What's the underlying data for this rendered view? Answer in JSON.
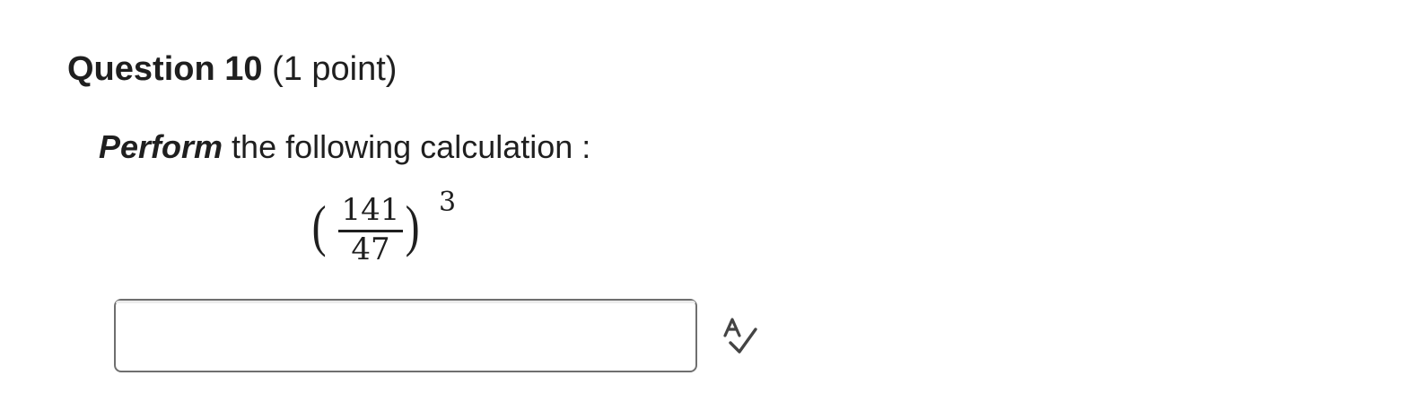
{
  "question": {
    "title": "Question 10",
    "points": "(1 point)"
  },
  "prompt": {
    "emphasis": "Perform",
    "text": " the following calculation :"
  },
  "expression": {
    "numerator": "141",
    "denominator": "47",
    "exponent": "3",
    "left_paren": "(",
    "right_paren": ")"
  },
  "answer": {
    "value": "",
    "placeholder": ""
  },
  "icons": {
    "spellcheck": "spellcheck-icon"
  }
}
